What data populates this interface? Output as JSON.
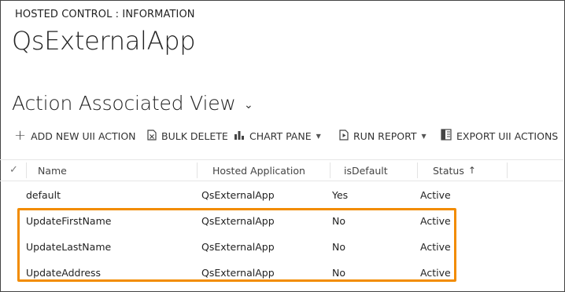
{
  "breadcrumb": "HOSTED CONTROL : INFORMATION",
  "record_title": "QsExternalApp",
  "view": {
    "title": "Action Associated View",
    "chevron": "⌄"
  },
  "toolbar": {
    "add_label": "ADD NEW UII ACTION",
    "bulk_delete_label": "BULK DELETE",
    "chart_pane_label": "CHART PANE",
    "run_report_label": "RUN REPORT",
    "export_label": "EXPORT UII ACTIONS"
  },
  "grid": {
    "columns": [
      "Name",
      "Hosted Application",
      "isDefault",
      "Status"
    ],
    "sort_indicator": "↑",
    "rows": [
      {
        "name": "default",
        "hosted_application": "QsExternalApp",
        "is_default": "Yes",
        "status": "Active"
      },
      {
        "name": "UpdateFirstName",
        "hosted_application": "QsExternalApp",
        "is_default": "No",
        "status": "Active"
      },
      {
        "name": "UpdateLastName",
        "hosted_application": "QsExternalApp",
        "is_default": "No",
        "status": "Active"
      },
      {
        "name": "UpdateAddress",
        "hosted_application": "QsExternalApp",
        "is_default": "No",
        "status": "Active"
      }
    ]
  },
  "colors": {
    "highlight": "#f28c00",
    "text": "#222222"
  }
}
